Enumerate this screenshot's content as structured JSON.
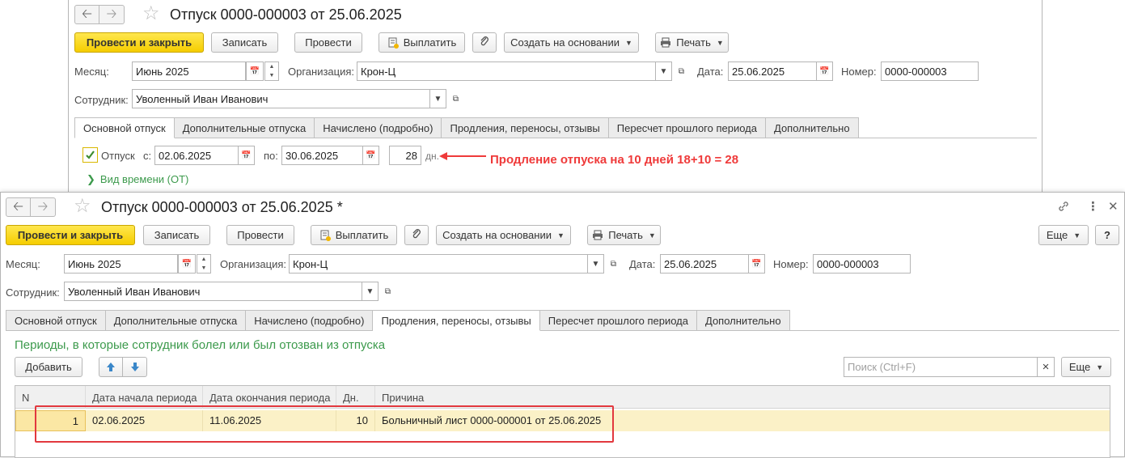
{
  "win1": {
    "title": "Отпуск 0000-000003 от 25.06.2025",
    "toolbar": {
      "post_close": "Провести и закрыть",
      "save": "Записать",
      "post": "Провести",
      "pay": "Выплатить",
      "create_based": "Создать на основании",
      "print": "Печать"
    },
    "month_label": "Месяц:",
    "month_value": "Июнь 2025",
    "org_label": "Организация:",
    "org_value": "Крон-Ц",
    "date_label": "Дата:",
    "date_value": "25.06.2025",
    "number_label": "Номер:",
    "number_value": "0000-000003",
    "employee_label": "Сотрудник:",
    "employee_value": "Уволенный Иван Иванович",
    "tabs": [
      "Основной отпуск",
      "Дополнительные отпуска",
      "Начислено (подробно)",
      "Продления, переносы, отзывы",
      "Пересчет прошлого периода",
      "Дополнительно"
    ],
    "vacation_label": "Отпуск",
    "from_label": "с:",
    "from_value": "02.06.2025",
    "to_label": "по:",
    "to_value": "30.06.2025",
    "days_value": "28",
    "days_unit": "дн.",
    "time_type": "Вид времени (ОТ)",
    "annotation": "Продление отпуска на 10 дней 18+10 = 28"
  },
  "win2": {
    "title": "Отпуск 0000-000003 от 25.06.2025 *",
    "toolbar": {
      "post_close": "Провести и закрыть",
      "save": "Записать",
      "post": "Провести",
      "pay": "Выплатить",
      "create_based": "Создать на основании",
      "print": "Печать",
      "more": "Еще",
      "help": "?"
    },
    "month_label": "Месяц:",
    "month_value": "Июнь 2025",
    "org_label": "Организация:",
    "org_value": "Крон-Ц",
    "date_label": "Дата:",
    "date_value": "25.06.2025",
    "number_label": "Номер:",
    "number_value": "0000-000003",
    "employee_label": "Сотрудник:",
    "employee_value": "Уволенный Иван Иванович",
    "tabs": [
      "Основной отпуск",
      "Дополнительные отпуска",
      "Начислено (подробно)",
      "Продления, переносы, отзывы",
      "Пересчет прошлого периода",
      "Дополнительно"
    ],
    "section_title": "Периоды, в которые сотрудник болел или был отозван из отпуска",
    "add_button": "Добавить",
    "search_placeholder": "Поиск (Ctrl+F)",
    "search_clear": "×",
    "more2": "Еще",
    "table": {
      "headers": [
        "N",
        "Дата начала периода",
        "Дата окончания периода",
        "Дн.",
        "Причина"
      ],
      "rows": [
        [
          "1",
          "02.06.2025",
          "11.06.2025",
          "10",
          "Больничный лист 0000-000001 от 25.06.2025"
        ]
      ]
    }
  },
  "colors": {
    "primary_button": "#f5cd00",
    "green_text": "#3c9a4c",
    "annotation_red": "#ef3a3a",
    "selected_row": "#fbf1c7"
  }
}
